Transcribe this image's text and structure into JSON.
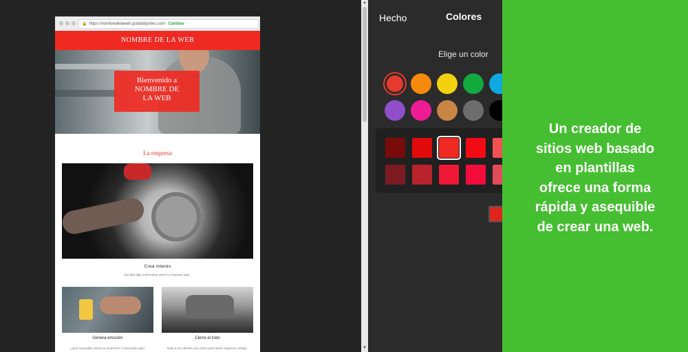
{
  "browser": {
    "url": "https://nombredelaweb.godaddysites.com",
    "change_link": "Cambiar"
  },
  "site": {
    "header_title": "NOMBRE DE LA WEB",
    "hero_lines": [
      "Bienvenido a",
      "NOMBRE DE",
      "LA WEB"
    ],
    "section_title": "La empresa",
    "main_caption_title": "Crea interés",
    "main_caption_sub": "Escribe algo interesante sobre tu empresa aquí.",
    "thumbs": [
      {
        "title": "Genera emoción",
        "sub": "¿Qué maravillas ofrece tu empresa? Comunícalo aquí."
      },
      {
        "title": "Cierra el trato",
        "sub": "Dale a tus clientes una razón para hacer negocios contigo."
      }
    ]
  },
  "panel": {
    "done_label": "Hecho",
    "title": "Colores",
    "choose_label": "Elige un color",
    "colors_row1": [
      "#e53a2d",
      "#f58a0d",
      "#f4d10f",
      "#12a93e",
      "#10a9e0"
    ],
    "colors_row2": [
      "#8e4fc9",
      "#ee1c94",
      "#c98545",
      "#6d6d6d",
      "#000000"
    ],
    "shades_row1": [
      "#7a0b0b",
      "#e10b0b",
      "#ef2a23",
      "#f20a14",
      "#f05254"
    ],
    "shades_row2": [
      "#7c1a22",
      "#b8232d",
      "#ef1937",
      "#f20d3d",
      "#e14c5a"
    ],
    "selected_color_index": 0,
    "selected_shade_index": 2,
    "bottom_swatch_color": "#e0251c"
  },
  "promo": {
    "background": "#45bf31",
    "lines": [
      "Un creador de",
      "sitios web basado",
      "en plantillas",
      "ofrece una forma",
      "rápida y asequible",
      "de crear una web."
    ]
  }
}
